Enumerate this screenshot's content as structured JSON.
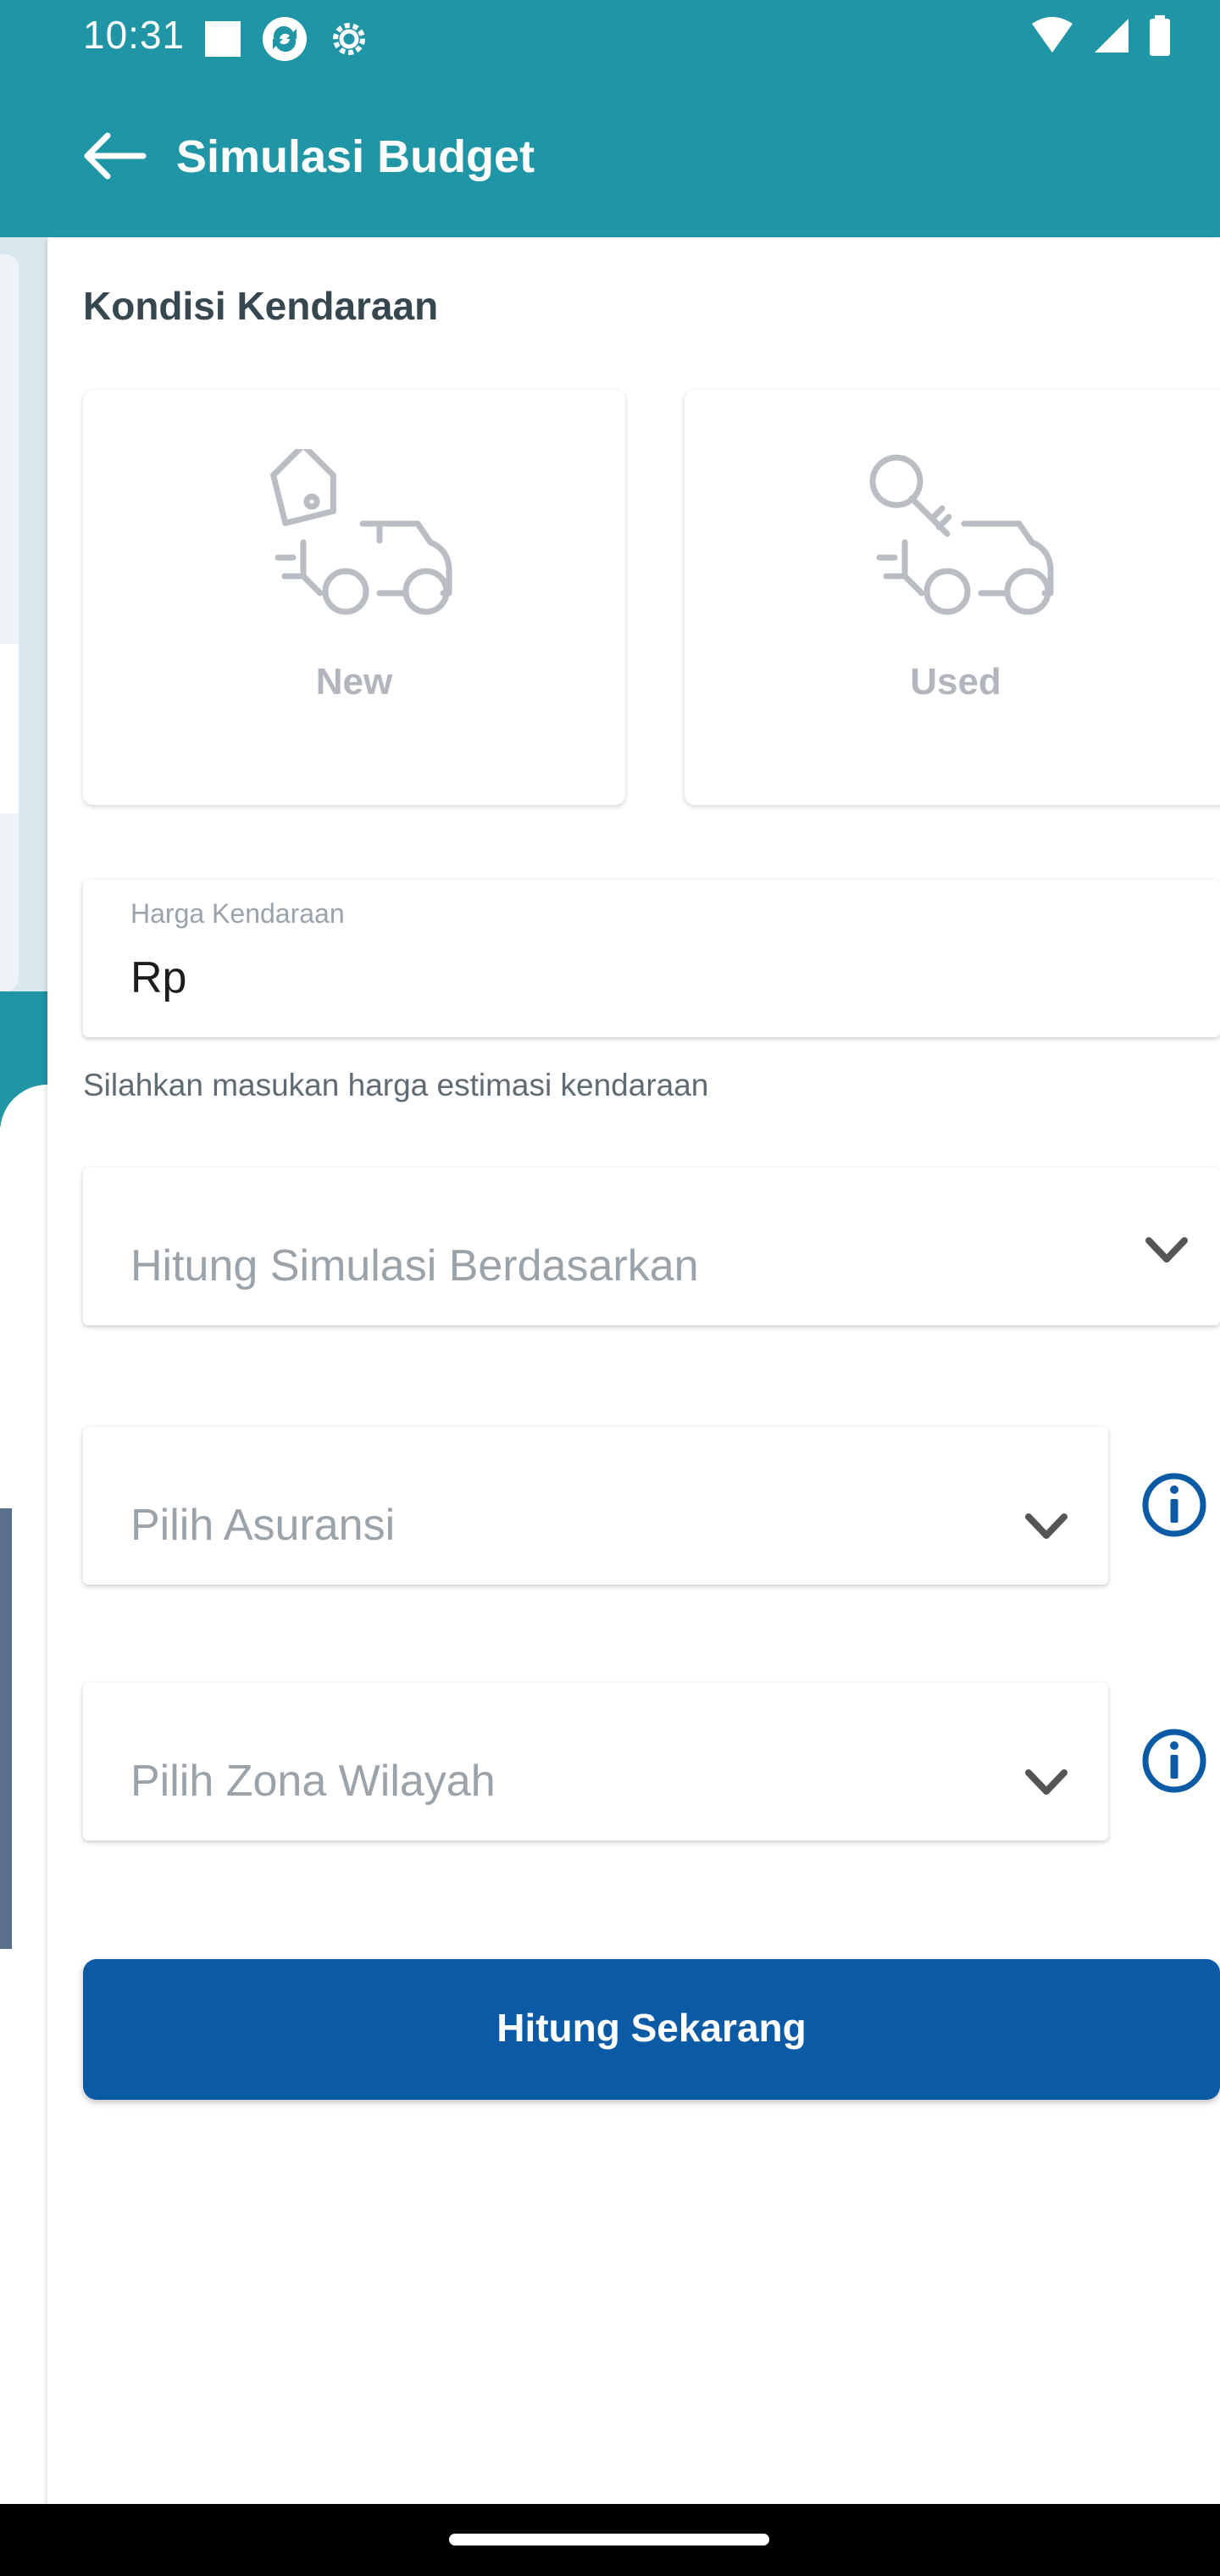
{
  "status_bar": {
    "time": "10:31",
    "left_icons": [
      "notification-square-icon",
      "sync-icon",
      "settings-gear-icon"
    ],
    "right_icons": [
      "wifi-icon",
      "signal-icon",
      "battery-icon"
    ]
  },
  "app_bar": {
    "title": "Simulasi Budget",
    "back_icon": "arrow-left-icon",
    "color": "#1f95a6"
  },
  "form": {
    "section_title": "Kondisi Kendaraan",
    "conditions": [
      {
        "label": "New",
        "icon": "car-price-tag-icon"
      },
      {
        "label": "Used",
        "icon": "car-key-icon"
      }
    ],
    "price_field": {
      "label": "Harga Kendaraan",
      "value": "Rp",
      "helper": "Silahkan masukan harga estimasi kendaraan"
    },
    "simulation_basis": {
      "placeholder": "Hitung Simulasi Berdasarkan"
    },
    "insurance": {
      "placeholder": "Pilih Asuransi"
    },
    "zone": {
      "placeholder": "Pilih Zona Wilayah"
    },
    "submit_label": "Hitung Sekarang",
    "primary_color": "#0a5aa6"
  }
}
